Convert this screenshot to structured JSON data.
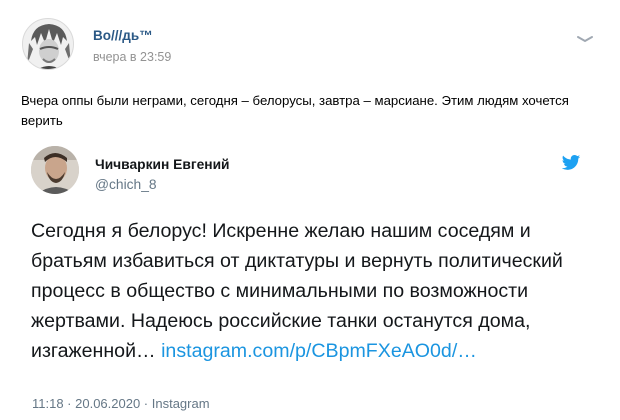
{
  "post": {
    "author": "Во///дь™",
    "time": "вчера в 23:59",
    "text": "Вчера оппы были неграми, сегодня – белорусы, завтра – марсиане. Этим людям хочется верить"
  },
  "tweet": {
    "name": "Чичваркин Евгений",
    "handle": "@chich_8",
    "text": "Сегодня я белорус! Искренне желаю нашим соседям и братьям избавиться от диктатуры и вернуть политический процесс в общество с минимальными по возможности жертвами.  Надеюсь российские танки останутся дома, изгаженной…",
    "link": "instagram.com/p/CBpmFXeAO0d/…",
    "date": "11:18 · 20.06.2020 · Instagram"
  },
  "icons": {
    "more": "more-horizontal-icon",
    "twitter": "twitter-bird-icon"
  },
  "colors": {
    "author_link": "#2a5885",
    "meta_gray": "#939393",
    "tweet_link": "#1b95e0",
    "twitter_blue": "#1da1f2"
  }
}
